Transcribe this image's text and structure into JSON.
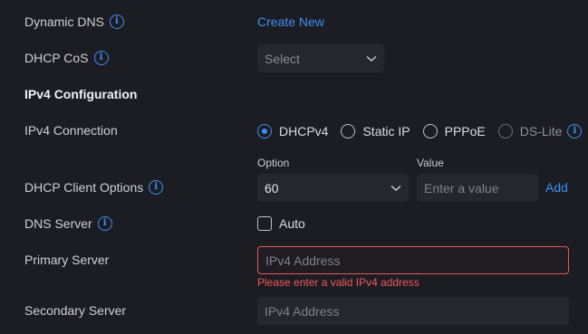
{
  "dynamic_dns": {
    "label": "Dynamic DNS",
    "action": "Create New"
  },
  "dhcp_cos": {
    "label": "DHCP CoS",
    "select_placeholder": "Select"
  },
  "ipv4_section": {
    "title": "IPv4 Configuration"
  },
  "ipv4_connection": {
    "label": "IPv4 Connection",
    "options": [
      "DHCPv4",
      "Static IP",
      "PPPoE",
      "DS-Lite"
    ],
    "selected": "DHCPv4"
  },
  "dhcp_client_options": {
    "label": "DHCP Client Options",
    "option_label": "Option",
    "option_value": "60",
    "value_label": "Value",
    "value_placeholder": "Enter a value",
    "add_label": "Add"
  },
  "dns_server": {
    "label": "DNS Server",
    "auto_label": "Auto",
    "auto_checked": false
  },
  "primary_server": {
    "label": "Primary Server",
    "placeholder": "IPv4 Address",
    "error": "Please enter a valid IPv4 address"
  },
  "secondary_server": {
    "label": "Secondary Server",
    "placeholder": "IPv4 Address"
  },
  "colors": {
    "accent": "#3e8ef7",
    "error": "#e5575c",
    "background": "#1c1d22"
  }
}
